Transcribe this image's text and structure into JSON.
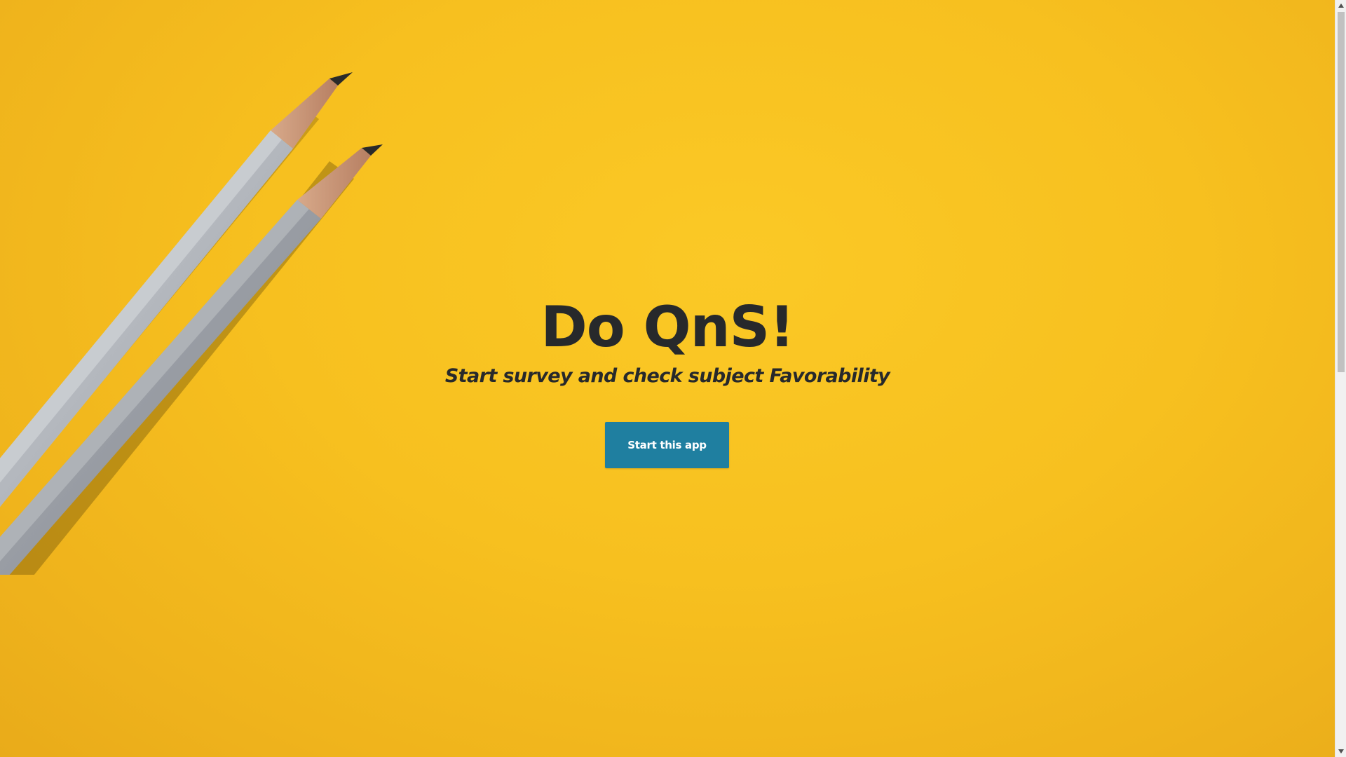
{
  "hero": {
    "title": "Do QnS!",
    "subtitle": "Start survey and check subject Favorability",
    "start_button_label": "Start this app",
    "background_color": "#f7c01f",
    "button_color": "#1f7fa0",
    "text_color": "#27292b"
  },
  "decoration": {
    "image_subject": "pencils-image"
  },
  "scrollbar": {
    "up_icon": "triangle-up-icon",
    "down_icon": "triangle-down-icon"
  }
}
